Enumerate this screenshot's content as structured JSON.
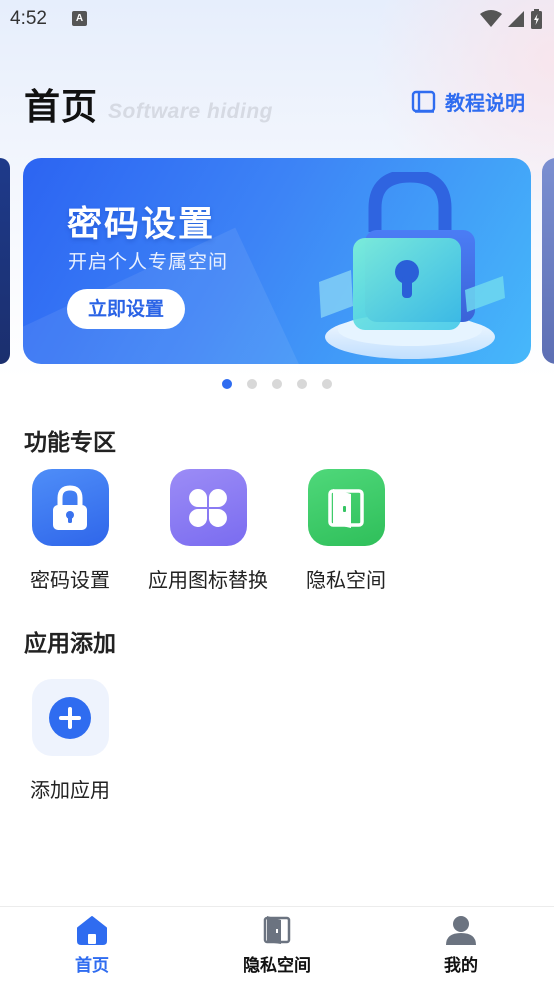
{
  "status_bar": {
    "time": "4:52",
    "notification_badge": "A"
  },
  "header": {
    "title": "首页",
    "subtitle": "Software hiding",
    "tutorial_label": "教程说明"
  },
  "banner": {
    "title": "密码设置",
    "subtitle": "开启个人专属空间",
    "button_label": "立即设置",
    "active_index": 0,
    "dot_count": 5
  },
  "features": {
    "section_title": "功能专区",
    "items": [
      {
        "label": "密码设置",
        "icon": "lock-icon"
      },
      {
        "label": "应用图标替换",
        "icon": "four-petal-icon"
      },
      {
        "label": "隐私空间",
        "icon": "door-icon"
      }
    ]
  },
  "app_add": {
    "section_title": "应用添加",
    "items": [
      {
        "label": "添加应用",
        "icon": "plus-circle-icon"
      }
    ]
  },
  "bottom_nav": {
    "items": [
      {
        "label": "首页",
        "icon": "home-icon",
        "active": true
      },
      {
        "label": "隐私空间",
        "icon": "door-icon",
        "active": false
      },
      {
        "label": "我的",
        "icon": "user-icon",
        "active": false
      }
    ]
  },
  "colors": {
    "accent": "#2f6cf0",
    "banner_start": "#2c64f2",
    "banner_end": "#46b8fa"
  }
}
